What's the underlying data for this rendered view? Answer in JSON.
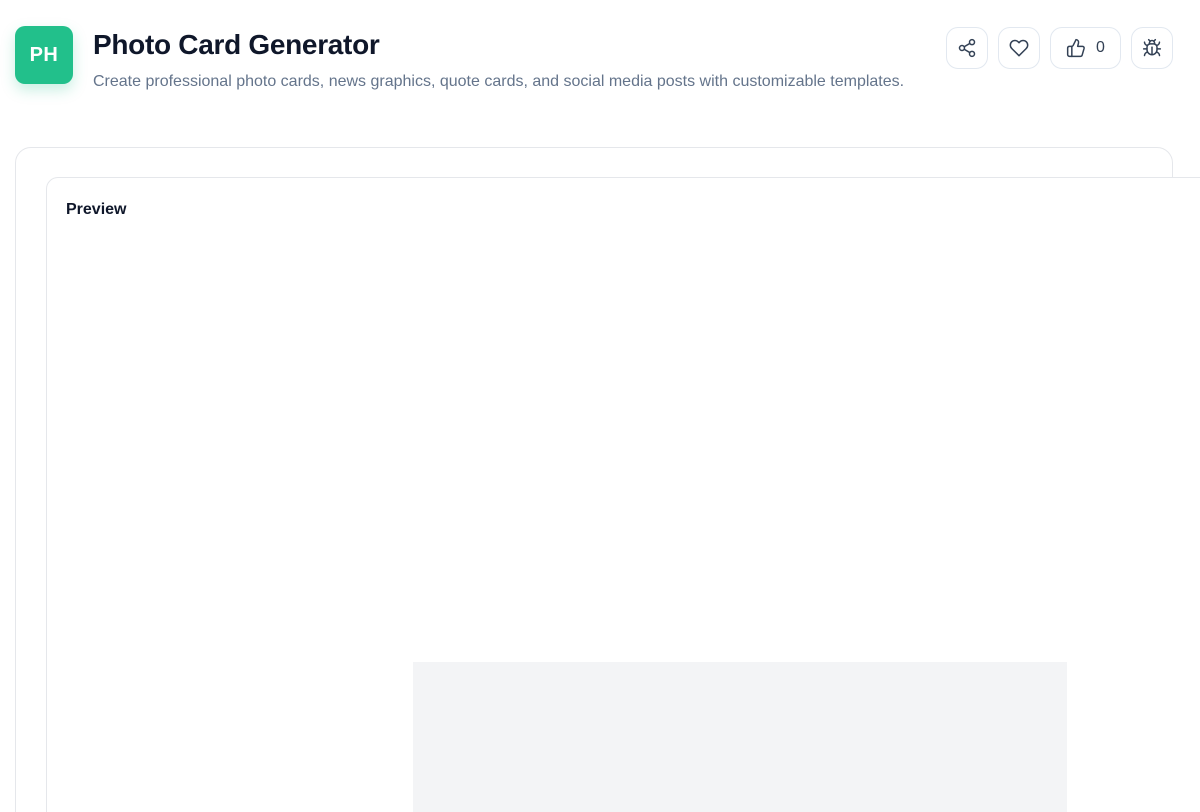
{
  "header": {
    "logo_text": "PH",
    "title": "Photo Card Generator",
    "description": "Create professional photo cards, news graphics, quote cards, and social media posts with customizable templates."
  },
  "actions": {
    "share_icon": "share-icon",
    "favorite_icon": "heart-icon",
    "like_icon": "thumbs-up-icon",
    "like_count": "0",
    "report_icon": "bug-icon"
  },
  "preview": {
    "title": "Preview"
  },
  "colors": {
    "accent": "#22c08b",
    "text_primary": "#0f172a",
    "text_muted": "#64748b",
    "border": "#e5e7eb",
    "placeholder": "#f3f4f6"
  }
}
